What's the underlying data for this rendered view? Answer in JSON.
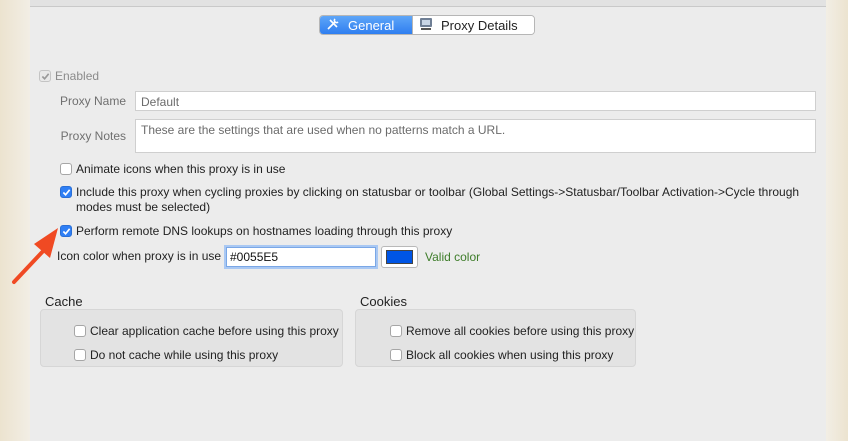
{
  "tabs": [
    {
      "label": "General",
      "icon": "wrench-screwdriver-icon",
      "active": true
    },
    {
      "label": "Proxy Details",
      "icon": "network-icon",
      "active": false
    }
  ],
  "enabled": {
    "label": "Enabled",
    "checked": true
  },
  "proxy_name": {
    "label": "Proxy Name",
    "value": "Default"
  },
  "proxy_notes": {
    "label": "Proxy Notes",
    "value": "These are the settings that are used when no patterns match a URL."
  },
  "options": [
    {
      "label": "Animate icons when this proxy is in use",
      "checked": false
    },
    {
      "label": "Include this proxy when cycling proxies by clicking on statusbar or toolbar (Global Settings->Statusbar/Toolbar Activation->Cycle through modes must be selected)",
      "checked": true
    },
    {
      "label": "Perform remote DNS lookups on hostnames loading through this proxy",
      "checked": true
    }
  ],
  "icon_color": {
    "label": "Icon color when proxy is in use",
    "value": "#0055E5",
    "swatch": "#0055E5",
    "status": "Valid color"
  },
  "cache": {
    "title": "Cache",
    "items": [
      {
        "label": "Clear application cache before using this proxy",
        "checked": false
      },
      {
        "label": "Do not cache while using this proxy",
        "checked": false
      }
    ]
  },
  "cookies": {
    "title": "Cookies",
    "items": [
      {
        "label": "Remove all cookies before using this proxy",
        "checked": false
      },
      {
        "label": "Block all cookies when using this proxy",
        "checked": false
      }
    ]
  },
  "colors": {
    "accent": "#2f7ff5",
    "annotation_arrow": "#f04a23",
    "valid": "#3e7d2a"
  }
}
